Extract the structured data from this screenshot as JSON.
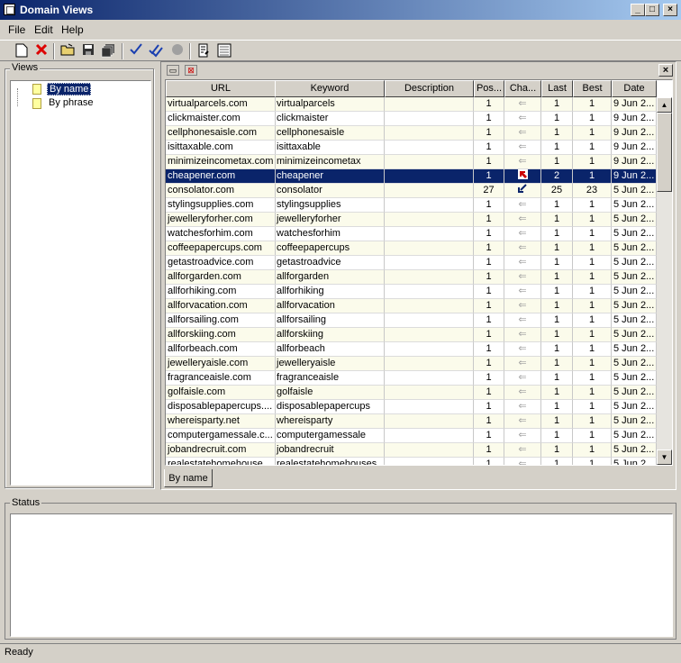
{
  "window": {
    "title": "Domain Views"
  },
  "menu": [
    "File",
    "Edit",
    "Help"
  ],
  "toolbar": {
    "icons": [
      "new-icon",
      "delete-icon",
      "open-icon",
      "save-icon",
      "save-all-icon",
      "check-icon",
      "check-all-icon",
      "stop-icon",
      "script-icon",
      "export-icon"
    ]
  },
  "views": {
    "label": "Views",
    "items": [
      "By name",
      "By phrase"
    ],
    "selected": 0
  },
  "grid": {
    "columns": [
      "URL",
      "Keyword",
      "Description",
      "Pos...",
      "Cha...",
      "Last",
      "Best",
      "Date"
    ],
    "rows": [
      {
        "url": "virtualparcels.com",
        "keyword": "virtualparcels",
        "description": "",
        "pos": "1",
        "change": "same",
        "last": "1",
        "best": "1",
        "date": "9 Jun 2..."
      },
      {
        "url": "clickmaister.com",
        "keyword": "clickmaister",
        "description": "",
        "pos": "1",
        "change": "same",
        "last": "1",
        "best": "1",
        "date": "9 Jun 2..."
      },
      {
        "url": "cellphonesaisle.com",
        "keyword": "cellphonesaisle",
        "description": "",
        "pos": "1",
        "change": "same",
        "last": "1",
        "best": "1",
        "date": "9 Jun 2..."
      },
      {
        "url": "isittaxable.com",
        "keyword": "isittaxable",
        "description": "",
        "pos": "1",
        "change": "same",
        "last": "1",
        "best": "1",
        "date": "9 Jun 2..."
      },
      {
        "url": "minimizeincometax.com",
        "keyword": "minimizeincometax",
        "description": "",
        "pos": "1",
        "change": "same",
        "last": "1",
        "best": "1",
        "date": "9 Jun 2..."
      },
      {
        "url": "cheapener.com",
        "keyword": "cheapener",
        "description": "",
        "pos": "1",
        "change": "up",
        "last": "2",
        "best": "1",
        "date": "9 Jun 2..."
      },
      {
        "url": "consolator.com",
        "keyword": "consolator",
        "description": "",
        "pos": "27",
        "change": "down",
        "last": "25",
        "best": "23",
        "date": "5 Jun 2..."
      },
      {
        "url": "stylingsupplies.com",
        "keyword": "stylingsupplies",
        "description": "",
        "pos": "1",
        "change": "same",
        "last": "1",
        "best": "1",
        "date": "5 Jun 2..."
      },
      {
        "url": "jewelleryforher.com",
        "keyword": "jewelleryforher",
        "description": "",
        "pos": "1",
        "change": "same",
        "last": "1",
        "best": "1",
        "date": "5 Jun 2..."
      },
      {
        "url": "watchesforhim.com",
        "keyword": "watchesforhim",
        "description": "",
        "pos": "1",
        "change": "same",
        "last": "1",
        "best": "1",
        "date": "5 Jun 2..."
      },
      {
        "url": "coffeepapercups.com",
        "keyword": "coffeepapercups",
        "description": "",
        "pos": "1",
        "change": "same",
        "last": "1",
        "best": "1",
        "date": "5 Jun 2..."
      },
      {
        "url": "getastroadvice.com",
        "keyword": "getastroadvice",
        "description": "",
        "pos": "1",
        "change": "same",
        "last": "1",
        "best": "1",
        "date": "5 Jun 2..."
      },
      {
        "url": "allforgarden.com",
        "keyword": "allforgarden",
        "description": "",
        "pos": "1",
        "change": "same",
        "last": "1",
        "best": "1",
        "date": "5 Jun 2..."
      },
      {
        "url": "allforhiking.com",
        "keyword": "allforhiking",
        "description": "",
        "pos": "1",
        "change": "same",
        "last": "1",
        "best": "1",
        "date": "5 Jun 2..."
      },
      {
        "url": "allforvacation.com",
        "keyword": "allforvacation",
        "description": "",
        "pos": "1",
        "change": "same",
        "last": "1",
        "best": "1",
        "date": "5 Jun 2..."
      },
      {
        "url": "allforsailing.com",
        "keyword": "allforsailing",
        "description": "",
        "pos": "1",
        "change": "same",
        "last": "1",
        "best": "1",
        "date": "5 Jun 2..."
      },
      {
        "url": "allforskiing.com",
        "keyword": "allforskiing",
        "description": "",
        "pos": "1",
        "change": "same",
        "last": "1",
        "best": "1",
        "date": "5 Jun 2..."
      },
      {
        "url": "allforbeach.com",
        "keyword": "allforbeach",
        "description": "",
        "pos": "1",
        "change": "same",
        "last": "1",
        "best": "1",
        "date": "5 Jun 2..."
      },
      {
        "url": "jewelleryaisle.com",
        "keyword": "jewelleryaisle",
        "description": "",
        "pos": "1",
        "change": "same",
        "last": "1",
        "best": "1",
        "date": "5 Jun 2..."
      },
      {
        "url": "fragranceaisle.com",
        "keyword": "fragranceaisle",
        "description": "",
        "pos": "1",
        "change": "same",
        "last": "1",
        "best": "1",
        "date": "5 Jun 2..."
      },
      {
        "url": "golfaisle.com",
        "keyword": "golfaisle",
        "description": "",
        "pos": "1",
        "change": "same",
        "last": "1",
        "best": "1",
        "date": "5 Jun 2..."
      },
      {
        "url": "disposablepapercups....",
        "keyword": "disposablepapercups",
        "description": "",
        "pos": "1",
        "change": "same",
        "last": "1",
        "best": "1",
        "date": "5 Jun 2..."
      },
      {
        "url": "whereisparty.net",
        "keyword": "whereisparty",
        "description": "",
        "pos": "1",
        "change": "same",
        "last": "1",
        "best": "1",
        "date": "5 Jun 2..."
      },
      {
        "url": "computergamessale.c...",
        "keyword": "computergamessale",
        "description": "",
        "pos": "1",
        "change": "same",
        "last": "1",
        "best": "1",
        "date": "5 Jun 2..."
      },
      {
        "url": "jobandrecruit.com",
        "keyword": "jobandrecruit",
        "description": "",
        "pos": "1",
        "change": "same",
        "last": "1",
        "best": "1",
        "date": "5 Jun 2..."
      },
      {
        "url": "realestatehomehouse...",
        "keyword": "realestatehomehouses",
        "description": "",
        "pos": "1",
        "change": "same",
        "last": "1",
        "best": "1",
        "date": "5 Jun 2..."
      }
    ],
    "selected_row": 5
  },
  "tabs": [
    "By name"
  ],
  "status": {
    "label": "Status",
    "text": ""
  },
  "statusbar": {
    "text": "Ready"
  },
  "colors": {
    "selection": "#0a246a",
    "alt_row": "#fbfbeb",
    "up_arrow": "#cc0000",
    "down_arrow": "#0a246a"
  }
}
